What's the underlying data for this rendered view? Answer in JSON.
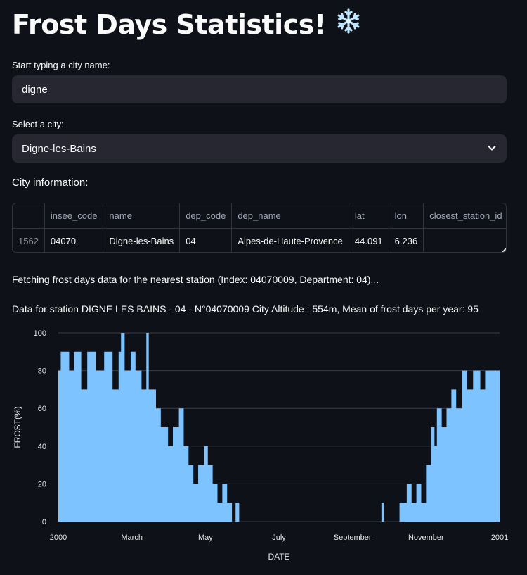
{
  "app": {
    "title": "Frost Days Statistics!",
    "title_icon": "snowflake-icon"
  },
  "search": {
    "label": "Start typing a city name:",
    "value": "digne"
  },
  "city_select": {
    "label": "Select a city:",
    "value": "Digne-les-Bains"
  },
  "city_info": {
    "heading": "City information:",
    "columns": [
      "insee_code",
      "name",
      "dep_code",
      "dep_name",
      "lat",
      "lon",
      "closest_station_id"
    ],
    "row": {
      "index": "1562",
      "insee_code": "04070",
      "name": "Digne-les-Bains",
      "dep_code": "04",
      "dep_name": "Alpes-de-Haute-Provence",
      "lat": "44.091",
      "lon": "6.236",
      "closest_station_id": ""
    }
  },
  "messages": {
    "fetching": "Fetching frost days data for the nearest station (Index: 04070009, Department: 04)...",
    "station": "Data for station DIGNE LES BAINS - 04 - N°04070009 City Altitude : 554m, Mean of frost days per year: 95"
  },
  "colors": {
    "background": "#0e1117",
    "input_bg": "#262730",
    "bar": "#7cc3ff",
    "grid": "#3a3d48"
  },
  "chart_data": {
    "type": "area",
    "xlabel": "DATE",
    "ylabel": "FROST(%)",
    "ylim": [
      0,
      100
    ],
    "yticks": [
      "0",
      "20",
      "40",
      "60",
      "80",
      "100"
    ],
    "xticks": [
      "2000",
      "March",
      "May",
      "July",
      "September",
      "November",
      "2001"
    ],
    "grid": true,
    "series": [
      {
        "x_start": "2000-01-01",
        "x_end": "2001-01-01",
        "points": [
          [
            "2000-01-01",
            80
          ],
          [
            "2000-01-03",
            90
          ],
          [
            "2000-01-10",
            80
          ],
          [
            "2000-01-14",
            90
          ],
          [
            "2000-01-20",
            70
          ],
          [
            "2000-01-25",
            90
          ],
          [
            "2000-02-01",
            80
          ],
          [
            "2000-02-08",
            90
          ],
          [
            "2000-02-15",
            70
          ],
          [
            "2000-02-20",
            90
          ],
          [
            "2000-02-22",
            100
          ],
          [
            "2000-02-25",
            80
          ],
          [
            "2000-03-01",
            90
          ],
          [
            "2000-03-05",
            80
          ],
          [
            "2000-03-10",
            70
          ],
          [
            "2000-03-14",
            100
          ],
          [
            "2000-03-16",
            70
          ],
          [
            "2000-03-22",
            60
          ],
          [
            "2000-03-26",
            50
          ],
          [
            "2000-04-01",
            40
          ],
          [
            "2000-04-05",
            50
          ],
          [
            "2000-04-10",
            60
          ],
          [
            "2000-04-14",
            40
          ],
          [
            "2000-04-18",
            30
          ],
          [
            "2000-04-22",
            20
          ],
          [
            "2000-04-26",
            30
          ],
          [
            "2000-05-01",
            40
          ],
          [
            "2000-05-04",
            30
          ],
          [
            "2000-05-08",
            20
          ],
          [
            "2000-05-12",
            10
          ],
          [
            "2000-05-16",
            20
          ],
          [
            "2000-05-20",
            10
          ],
          [
            "2000-05-24",
            0
          ],
          [
            "2000-05-27",
            10
          ],
          [
            "2000-05-30",
            0
          ],
          [
            "2000-09-25",
            10
          ],
          [
            "2000-09-27",
            0
          ],
          [
            "2000-10-10",
            10
          ],
          [
            "2000-10-16",
            20
          ],
          [
            "2000-10-20",
            10
          ],
          [
            "2000-10-24",
            20
          ],
          [
            "2000-10-28",
            10
          ],
          [
            "2000-11-01",
            30
          ],
          [
            "2000-11-05",
            50
          ],
          [
            "2000-11-08",
            40
          ],
          [
            "2000-11-10",
            60
          ],
          [
            "2000-11-14",
            50
          ],
          [
            "2000-11-18",
            60
          ],
          [
            "2000-11-22",
            70
          ],
          [
            "2000-11-26",
            60
          ],
          [
            "2000-12-01",
            80
          ],
          [
            "2000-12-05",
            70
          ],
          [
            "2000-12-10",
            80
          ],
          [
            "2000-12-16",
            70
          ],
          [
            "2000-12-20",
            80
          ],
          [
            "2000-12-31",
            80
          ]
        ]
      }
    ]
  }
}
